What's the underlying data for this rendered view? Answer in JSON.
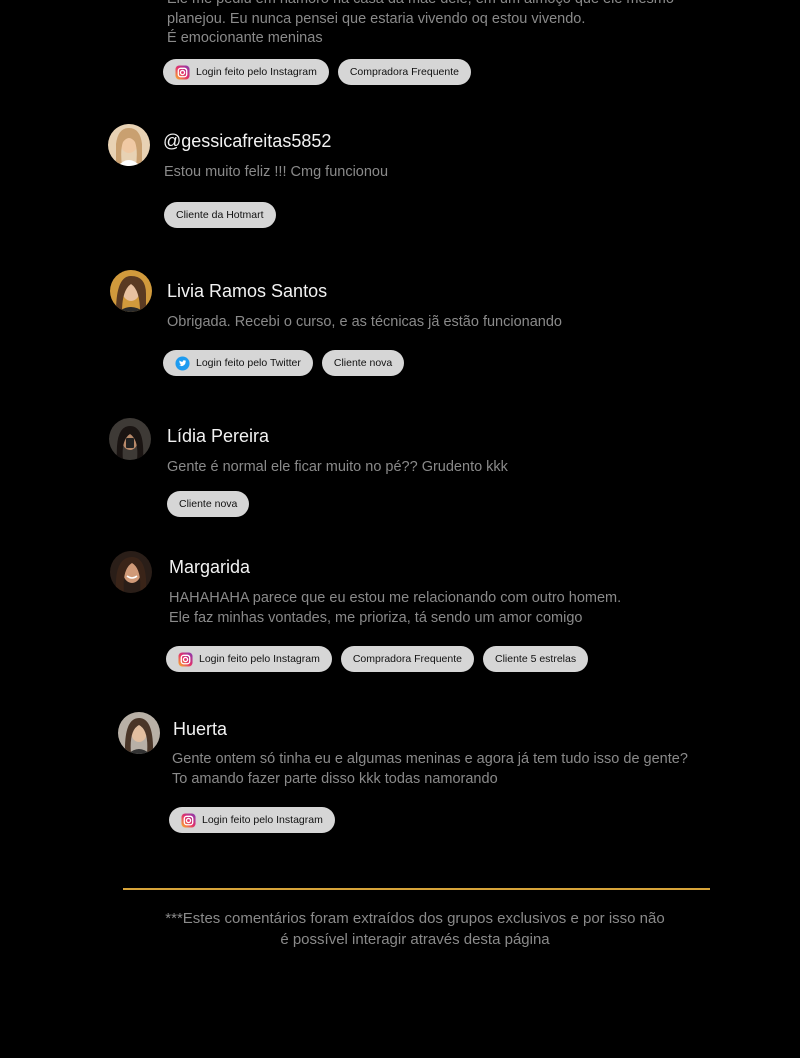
{
  "top_comment": {
    "lines": [
      "Ele me pediu em namoro na casa da mãe dele, em um almoço que ele mesmo",
      "planejou. Eu nunca pensei que estaria vivendo oq estou vivendo.",
      "É emocionante meninas"
    ],
    "badges": [
      {
        "label": "Login feito pelo Instagram",
        "icon": "instagram-icon"
      },
      {
        "label": "Compradora Frequente",
        "icon": ""
      }
    ]
  },
  "comments": [
    {
      "name": "@gessicafreitas5852",
      "lines": [
        "Estou muito feliz !!! Cmg funcionou"
      ],
      "badges": [
        {
          "label": "Cliente da Hotmart",
          "icon": ""
        }
      ],
      "avatar_color": "#d8b48a"
    },
    {
      "name": "Livia Ramos Santos",
      "lines": [
        "Obrigada. Recebi o curso, e as técnicas jã estão funcionando"
      ],
      "badges": [
        {
          "label": "Login feito pelo Twitter",
          "icon": "twitter-icon"
        },
        {
          "label": "Cliente nova",
          "icon": ""
        }
      ],
      "avatar_color": "#c08a3a"
    },
    {
      "name": "Lídia Pereira",
      "lines": [
        "Gente é normal ele ficar muito no pé?? Grudento kkk"
      ],
      "badges": [
        {
          "label": "Cliente nova",
          "icon": ""
        }
      ],
      "avatar_color": "#5a4a40"
    },
    {
      "name": "Margarida",
      "lines": [
        "HAHAHAHA parece que eu estou me relacionando com outro homem.",
        "Ele faz minhas vontades, me prioriza, tá sendo um amor comigo"
      ],
      "badges": [
        {
          "label": "Login feito pelo Instagram",
          "icon": "instagram-icon"
        },
        {
          "label": "Compradora Frequente",
          "icon": ""
        },
        {
          "label": "Cliente 5 estrelas",
          "icon": ""
        }
      ],
      "avatar_color": "#6b4a3a"
    },
    {
      "name": "Huerta",
      "lines": [
        "Gente ontem só tinha eu e algumas meninas e agora já tem tudo isso de gente?",
        "To amando fazer parte disso kkk todas namorando"
      ],
      "badges": [
        {
          "label": "Login feito pelo Instagram",
          "icon": "instagram-icon"
        }
      ],
      "avatar_color": "#9a8f85"
    }
  ],
  "footer": {
    "lines": [
      "***Estes comentários foram extraídos dos grupos exclusivos e por isso não",
      "é possível interagir através desta página"
    ]
  },
  "colors": {
    "background": "#000000",
    "badge_bg": "#d6d6d6",
    "divider": "#d7a43a",
    "twitter": "#1d9bf0"
  }
}
